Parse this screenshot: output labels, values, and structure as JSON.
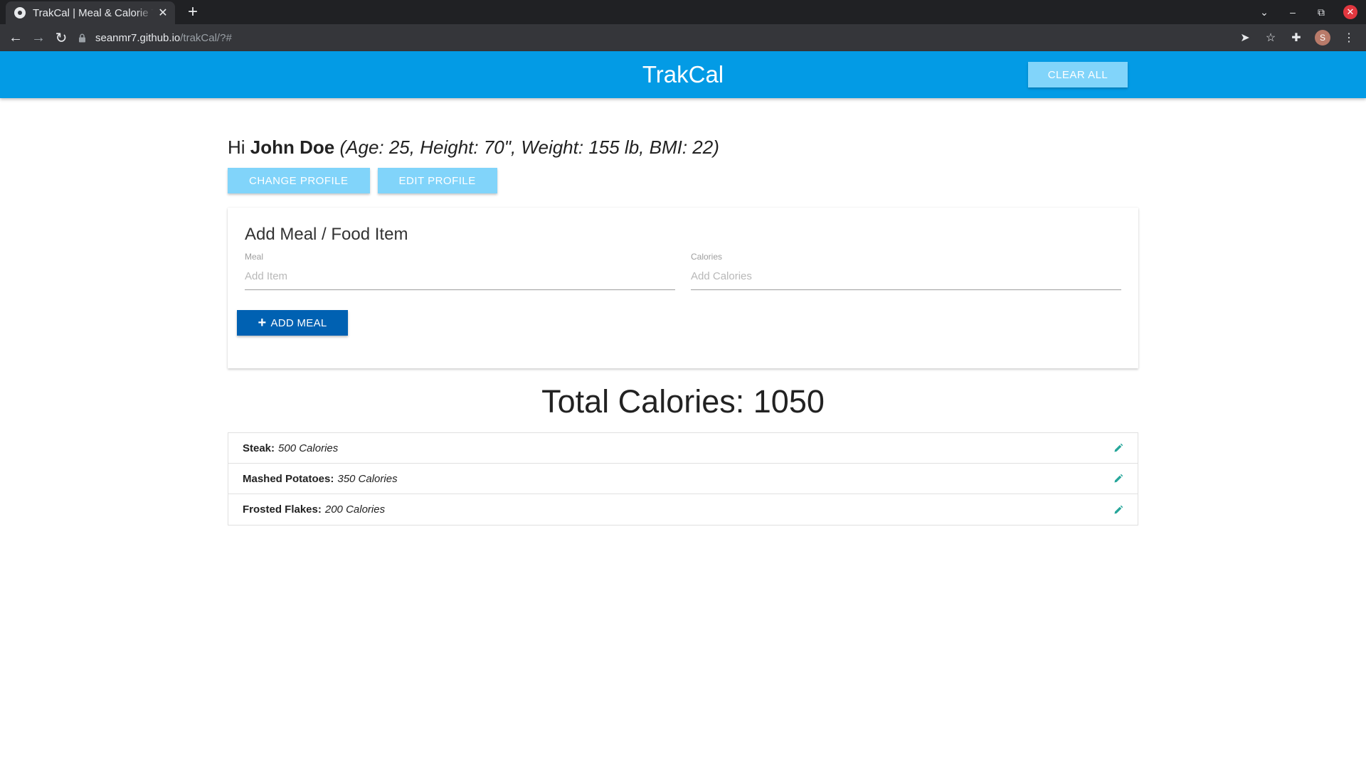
{
  "browser": {
    "tab_title": "TrakCal | Meal & Calorie Tracker",
    "url_host": "seanmr7.github.io",
    "url_path": "/trakCal/?#",
    "profile_initial": "S"
  },
  "app": {
    "brand": "TrakCal",
    "clear_all_label": "CLEAR ALL",
    "colors": {
      "nav": "#039be5",
      "light_button": "#81d4fa",
      "primary_button": "#0061b2",
      "edit_icon": "#26a69a"
    }
  },
  "profile": {
    "greeting_prefix": "Hi",
    "name": "John Doe",
    "stats": "(Age: 25, Height: 70\", Weight: 155 lb, BMI: 22)",
    "change_label": "CHANGE PROFILE",
    "edit_label": "EDIT PROFILE"
  },
  "form": {
    "title": "Add Meal / Food Item",
    "meal_label": "Meal",
    "meal_placeholder": "Add Item",
    "calories_label": "Calories",
    "calories_placeholder": "Add Calories",
    "add_label": "ADD MEAL"
  },
  "total": {
    "label": "Total Calories:",
    "value": "1050"
  },
  "items": [
    {
      "name": "Steak:",
      "calories": "500 Calories"
    },
    {
      "name": "Mashed Potatoes:",
      "calories": "350 Calories"
    },
    {
      "name": "Frosted Flakes:",
      "calories": "200 Calories"
    }
  ]
}
